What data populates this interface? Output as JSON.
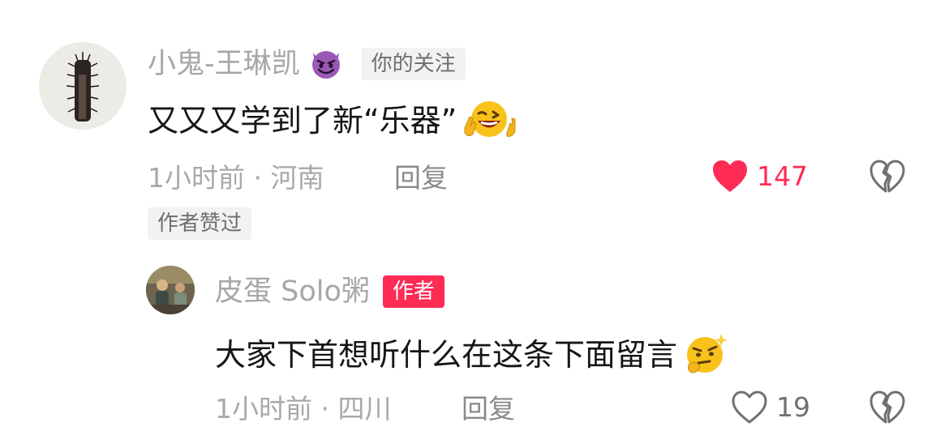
{
  "comments": [
    {
      "username": "小鬼-王琳凯",
      "user_emoji": "smiling-imp-emoji",
      "follow_tag": "你的关注",
      "text": "又又又学到了新“乐器”",
      "text_emoji": "winking-peace-emoji",
      "time_location": "1小时前 · 河南",
      "reply_label": "回复",
      "like_count": "147",
      "liked": true,
      "author_liked_tag": "作者赞过"
    },
    {
      "username": "皮蛋 Solo粥",
      "author_tag": "作者",
      "text": "大家下首想听什么在这条下面留言",
      "text_emoji": "thinking-sparkle-emoji",
      "time_location": "1小时前 · 四川",
      "reply_label": "回复",
      "like_count": "19",
      "liked": false
    }
  ],
  "colors": {
    "like_active": "#fe2c55",
    "author_tag_bg": "#fe2c55",
    "muted_text": "#a9a9a9",
    "main_text": "#161616"
  }
}
